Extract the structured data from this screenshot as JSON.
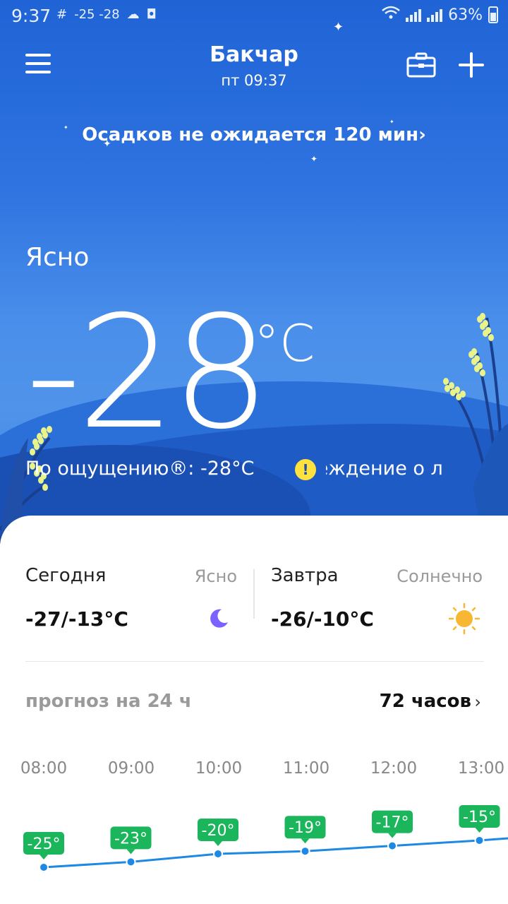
{
  "status_bar": {
    "time": "9:37",
    "notif_temps": "-25  -28",
    "battery": "63%"
  },
  "header": {
    "city": "Бакчар",
    "day_time": "пт  09:37"
  },
  "precipitation": {
    "text": "Осадков не ожидается 120 мин",
    "chevron": "›"
  },
  "current": {
    "condition": "Ясно",
    "temperature": "-28",
    "unit": "°C",
    "feels_like": "По ощущению®: -28°C",
    "warning_icon": "!",
    "warning_text": "преждение о л"
  },
  "today": {
    "label": "Сегодня",
    "condition": "Ясно",
    "temps": "-27/-13°C",
    "icon": "moon-icon"
  },
  "tomorrow": {
    "label": "Завтра",
    "condition": "Солнечно",
    "temps": "-26/-10°C",
    "icon": "sun-icon"
  },
  "forecast": {
    "title": "прогноз на 24 ч",
    "link": "72 часов",
    "chevron": "›",
    "hours": [
      "08:00",
      "09:00",
      "10:00",
      "11:00",
      "12:00",
      "13:00"
    ],
    "temps_c": [
      -25,
      -23,
      -20,
      -19,
      -17,
      -15
    ],
    "badges": [
      "-25°",
      "-23°",
      "-20°",
      "-19°",
      "-17°",
      "-15°"
    ],
    "badge_color": "#1bb55c",
    "line_color": "#1e88e5"
  },
  "colors": {
    "sky_top": "#1f63d6",
    "sky_mid": "#4a8fea",
    "warning": "#ffe23d",
    "sun": "#f7b733",
    "moon": "#7b61ff"
  }
}
